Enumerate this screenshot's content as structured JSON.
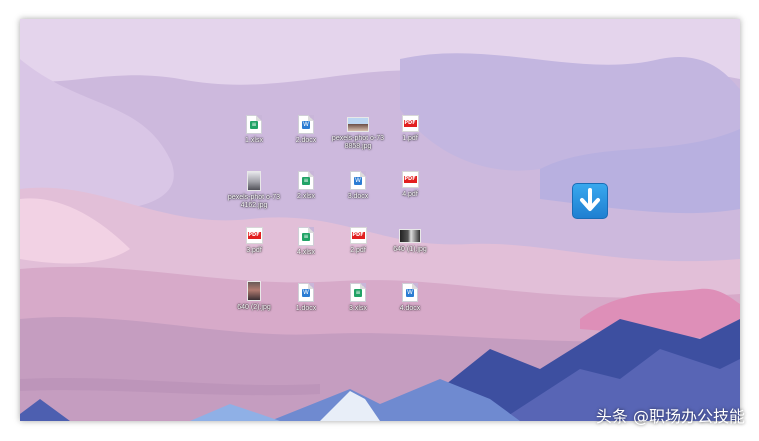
{
  "desktop": {
    "icons": [
      {
        "label": "1.xlsx",
        "type": "xlsx"
      },
      {
        "label": "2.docx",
        "type": "docx"
      },
      {
        "label": "pexels-phot o-738858.jpg",
        "type": "jpg"
      },
      {
        "label": "1.pdf",
        "type": "pdf"
      },
      {
        "label": "pexels-phot o-734162.jpg",
        "type": "jpg"
      },
      {
        "label": "2.xlsx",
        "type": "xlsx"
      },
      {
        "label": "3.docx",
        "type": "docx"
      },
      {
        "label": "4.pdf",
        "type": "pdf"
      },
      {
        "label": "3.pdf",
        "type": "pdf"
      },
      {
        "label": "4.xlsx",
        "type": "xlsx"
      },
      {
        "label": "2.pdf",
        "type": "pdf"
      },
      {
        "label": "640 (1).jpg",
        "type": "jpg"
      },
      {
        "label": "640 (2).jpg",
        "type": "jpg"
      },
      {
        "label": "1.docx",
        "type": "docx"
      },
      {
        "label": "3.xlsx",
        "type": "xlsx"
      },
      {
        "label": "4.docx",
        "type": "docx"
      }
    ],
    "download_icon": "down-arrow-icon"
  },
  "watermark": {
    "text": "头条 @职场办公技能"
  },
  "colors": {
    "xlsx": "#21a366",
    "docx": "#2b7cd3",
    "pdf": "#e21f1f",
    "arrow": "#2b90e3"
  }
}
